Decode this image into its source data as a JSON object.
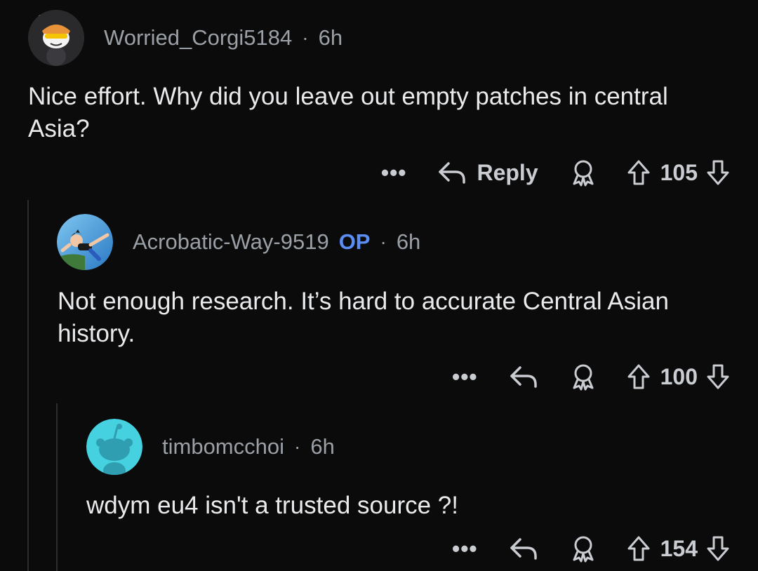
{
  "comments": [
    {
      "username": "Worried_Corgi5184",
      "time": "6h",
      "text": "Nice effort. Why did you leave out empty patches in central Asia?",
      "reply_label": "Reply",
      "votes": "105",
      "avatar": "snoo-with-sunglasses"
    },
    {
      "username": "Acrobatic-Way-9519",
      "op_label": "OP",
      "time": "6h",
      "text": "Not enough research. It’s hard to accurate Central Asian history.",
      "votes": "100",
      "avatar": "astro-boy-flying"
    },
    {
      "username": "timbomcchoi",
      "time": "6h",
      "text": "wdym eu4 isn't a trusted source ?!",
      "votes": "154",
      "avatar": "default-snoo-cyan"
    }
  ],
  "separator": "·",
  "more_label": "•••",
  "colors": {
    "background": "#0b0b0c",
    "username": "#9aa0a6",
    "op": "#5b8ef5",
    "text": "#e9eaec",
    "thread_line": "#2b2d30"
  }
}
